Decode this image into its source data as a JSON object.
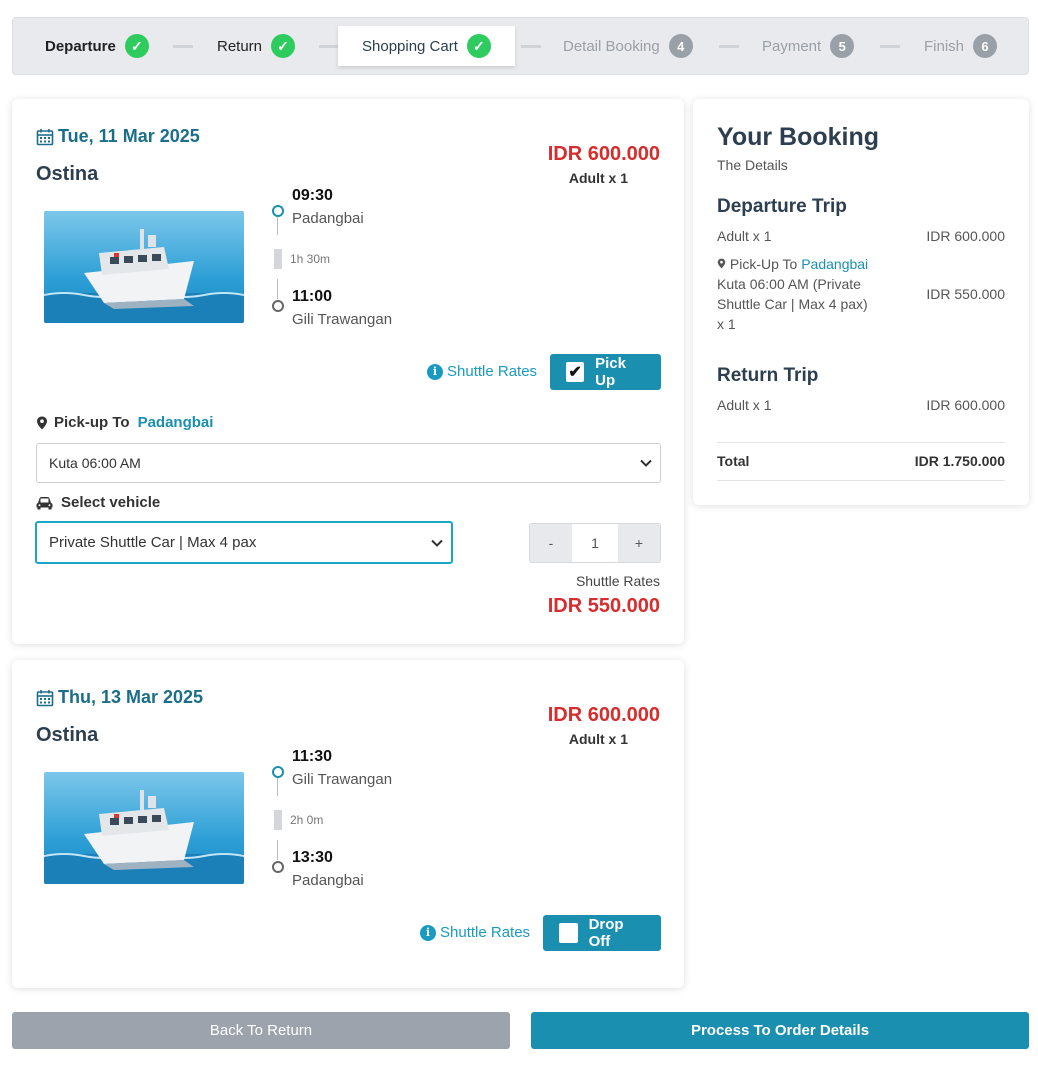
{
  "stepper": {
    "steps": [
      {
        "label": "Departure",
        "state": "done",
        "badge": "✓"
      },
      {
        "label": "Return",
        "state": "done",
        "badge": "✓"
      },
      {
        "label": "Shopping Cart",
        "state": "active",
        "badge": "✓"
      },
      {
        "label": "Detail Booking",
        "state": "pending",
        "badge": "4"
      },
      {
        "label": "Payment",
        "state": "pending",
        "badge": "5"
      },
      {
        "label": "Finish",
        "state": "pending",
        "badge": "6"
      }
    ]
  },
  "trips": [
    {
      "date": "Tue, 11 Mar 2025",
      "operator": "Ostina",
      "price": "IDR 600.000",
      "pax": "Adult x 1",
      "depart_time": "09:30",
      "depart_place": "Padangbai",
      "duration": "1h 30m",
      "arrive_time": "11:00",
      "arrive_place": "Gili Trawangan",
      "shuttle_link": "Shuttle Rates",
      "toggle_label": "Pick Up",
      "toggle_checked": true,
      "pickup_label": "Pick-up To",
      "pickup_place": "Padangbai",
      "pickup_select": "Kuta 06:00 AM",
      "vehicle_label": "Select vehicle",
      "vehicle_select": "Private Shuttle Car | Max 4 pax",
      "qty_minus": "-",
      "qty_value": "1",
      "qty_plus": "+",
      "rate_label": "Shuttle Rates",
      "rate_price": "IDR 550.000"
    },
    {
      "date": "Thu, 13 Mar 2025",
      "operator": "Ostina",
      "price": "IDR 600.000",
      "pax": "Adult x 1",
      "depart_time": "11:30",
      "depart_place": "Gili Trawangan",
      "duration": "2h 0m",
      "arrive_time": "13:30",
      "arrive_place": "Padangbai",
      "shuttle_link": "Shuttle Rates",
      "toggle_label": "Drop Off",
      "toggle_checked": false
    }
  ],
  "summary": {
    "title": "Your Booking",
    "subtitle": "The Details",
    "departure_heading": "Departure Trip",
    "departure_adult": "Adult x 1",
    "departure_adult_price": "IDR 600.000",
    "pickup_prefix": "Pick-Up To",
    "pickup_place": "Padangbai",
    "pickup_detail": "Kuta 06:00 AM (Private Shuttle Car | Max 4 pax) x 1",
    "pickup_price": "IDR 550.000",
    "return_heading": "Return Trip",
    "return_adult": "Adult x 1",
    "return_adult_price": "IDR 600.000",
    "total_label": "Total",
    "total_value": "IDR 1.750.000"
  },
  "actions": {
    "back": "Back To Return",
    "next": "Process To Order Details"
  },
  "colors": {
    "accent": "#1a8fb0",
    "price_red": "#d62d2d",
    "check_green": "#2ecc5e"
  }
}
